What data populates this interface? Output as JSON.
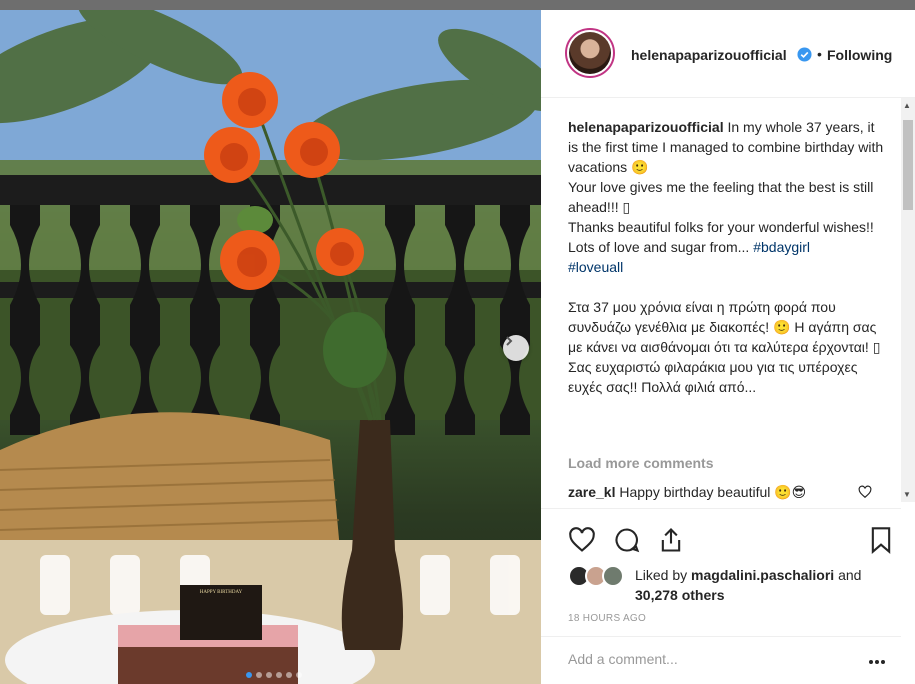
{
  "post": {
    "username": "helenapaparizouofficial",
    "follow_status": "Following",
    "bullet": "•",
    "caption_lines": [
      "In my whole 37 years, it is the first time I managed to combine birthday with vacations 🙂",
      "Your love gives me the feeling that the best is still ahead!!! ▯",
      "Thanks beautiful folks for your wonderful wishes!!",
      "Lots of love and sugar from... "
    ],
    "hashtags": [
      "#bdaygirl",
      "#loveuall"
    ],
    "greek_text": "Στα 37 μου χρόνια είναι η πρώτη φορά που συνδυάζω γενέθλια με διακοπές! 🙂 Η αγάπη σας με κάνει να αισθάνομαι ότι τα καλύτερα έρχονται! ▯ Σας ευχαριστώ φιλαράκια μου για τις υπέροχες ευχές σας!! Πολλά φιλιά από...",
    "load_more": "Load more comments",
    "comment": {
      "user": "zare_kl",
      "text": "Happy birthday beautiful 🙂😎"
    },
    "liked_by_prefix": "Liked by ",
    "liked_by_user": "magdalini.paschaliori",
    "liked_by_and": " and",
    "liked_by_count": "30,278 others",
    "timestamp": "18 HOURS AGO",
    "add_comment_placeholder": "Add a comment...",
    "card_text": "HAPPY BIRTHDAY"
  },
  "carousel": {
    "dots": 6,
    "active_index": 0
  },
  "colors": {
    "accent": "#3897f0",
    "hashtag": "#003569",
    "muted": "#999999",
    "verified": "#3897f0"
  }
}
